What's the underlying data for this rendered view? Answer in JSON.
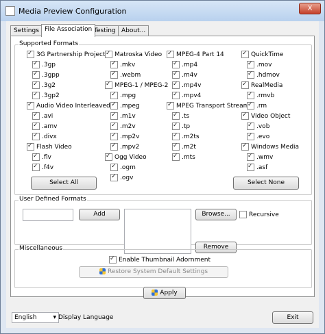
{
  "window": {
    "title": "Media Preview Configuration",
    "close_label": "X"
  },
  "tabs": [
    {
      "label": "Settings"
    },
    {
      "label": "File Association"
    },
    {
      "label": "Testing"
    },
    {
      "label": "About..."
    }
  ],
  "supported": {
    "title": "Supported Formats",
    "col1": [
      {
        "label": "3G Partnership Project"
      },
      {
        "label": ".3gp"
      },
      {
        "label": ".3gpp"
      },
      {
        "label": ".3g2"
      },
      {
        "label": ".3gp2"
      },
      {
        "label": "Audio Video Interleaved"
      },
      {
        "label": ".avi"
      },
      {
        "label": ".amv"
      },
      {
        "label": ".divx"
      },
      {
        "label": "Flash Video"
      },
      {
        "label": ".flv"
      },
      {
        "label": ".f4v"
      }
    ],
    "col2": [
      {
        "label": "Matroska Video"
      },
      {
        "label": ".mkv"
      },
      {
        "label": ".webm"
      },
      {
        "label": "MPEG-1 / MPEG-2"
      },
      {
        "label": ".mpg"
      },
      {
        "label": ".mpeg"
      },
      {
        "label": ".m1v"
      },
      {
        "label": ".m2v"
      },
      {
        "label": ".mp2v"
      },
      {
        "label": ".mpv2"
      },
      {
        "label": "Ogg Video"
      },
      {
        "label": ".ogm"
      },
      {
        "label": ".ogv"
      }
    ],
    "col3": [
      {
        "label": "MPEG-4 Part 14"
      },
      {
        "label": ".mp4"
      },
      {
        "label": ".m4v"
      },
      {
        "label": ".mp4v"
      },
      {
        "label": ".mpv4"
      },
      {
        "label": "MPEG Transport Stream"
      },
      {
        "label": ".ts"
      },
      {
        "label": ".tp"
      },
      {
        "label": ".m2ts"
      },
      {
        "label": ".m2t"
      },
      {
        "label": ".mts"
      }
    ],
    "col4": [
      {
        "label": "QuickTime"
      },
      {
        "label": ".mov"
      },
      {
        "label": ".hdmov"
      },
      {
        "label": "RealMedia"
      },
      {
        "label": ".rmvb"
      },
      {
        "label": ".rm"
      },
      {
        "label": "Video Object"
      },
      {
        "label": ".vob"
      },
      {
        "label": ".evo"
      },
      {
        "label": "Windows Media"
      },
      {
        "label": ".wmv"
      },
      {
        "label": ".asf"
      }
    ],
    "select_all": "Select All",
    "select_none": "Select None"
  },
  "user_defined": {
    "title": "User Defined Formats",
    "input_value": "",
    "add": "Add",
    "browse": "Browse...",
    "recursive": "Recursive",
    "remove": "Remove"
  },
  "misc": {
    "title": "Miscellaneous",
    "enable_thumb": "Enable Thumbnail Adornment",
    "restore": "Restore System Default Settings"
  },
  "apply": "Apply",
  "language": {
    "value": "English",
    "label": "Display Language"
  },
  "exit": "Exit"
}
